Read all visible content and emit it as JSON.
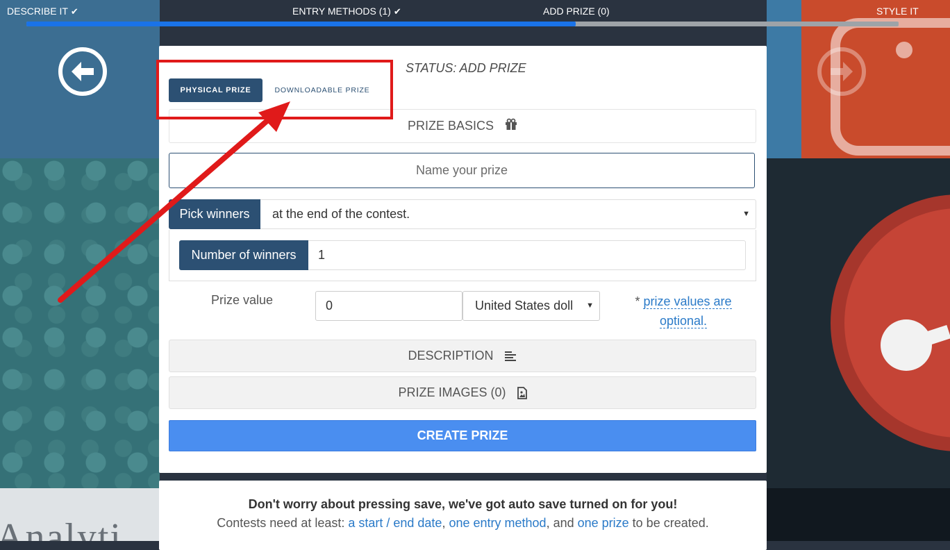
{
  "steps": [
    {
      "label": "DESCRIBE IT",
      "done": true
    },
    {
      "label": "ENTRY METHODS (1)",
      "done": true
    },
    {
      "label": "ADD PRIZE (0)",
      "done": false,
      "active": true
    },
    {
      "label": "STYLE IT",
      "done": false
    }
  ],
  "progress_fraction": 0.63,
  "status": "STATUS: ADD PRIZE",
  "tabs": {
    "physical": "PHYSICAL PRIZE",
    "downloadable": "DOWNLOADABLE PRIZE"
  },
  "sections": {
    "basics": "PRIZE BASICS",
    "description": "DESCRIPTION",
    "images": "PRIZE IMAGES (0)"
  },
  "form": {
    "name_placeholder": "Name your prize",
    "pick_label": "Pick winners",
    "pick_value": "at the end of the contest.",
    "winners_label": "Number of winners",
    "winners_value": "1",
    "prize_value_label": "Prize value",
    "prize_value": "0",
    "currency": "United States doll",
    "note_prefix": "* ",
    "note_link": "prize values are optional."
  },
  "create_button": "CREATE PRIZE",
  "autosave": {
    "headline": "Don't worry about pressing save, we've got auto save turned on for you!",
    "prefix": "Contests need at least: ",
    "link1": "a start / end date",
    "sep1": ", ",
    "link2": "one entry method",
    "sep2": ", and ",
    "link3": "one prize",
    "suffix": " to be created."
  },
  "icons": {
    "back": "arrow-left-circle-icon",
    "forward": "arrow-right-circle-icon",
    "gift": "gift-icon",
    "description": "align-left-icon",
    "images": "image-file-icon",
    "check": "check-icon",
    "caret": "caret-down-icon"
  },
  "colors": {
    "primary": "#2c5073",
    "accent": "#4a8ef0",
    "progress": "#1a73e8",
    "link": "#2a7ac8",
    "annotation": "#e01a1a"
  },
  "background_text": "Analyti"
}
